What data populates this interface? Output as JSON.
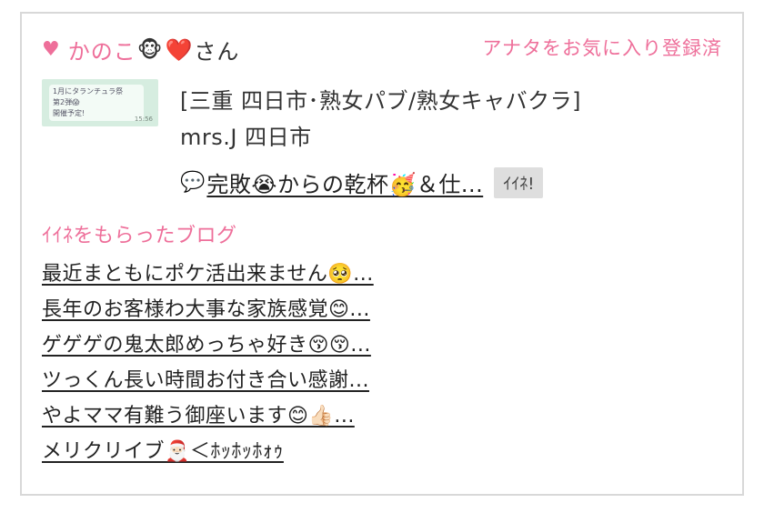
{
  "user": {
    "heart": "♥",
    "name": "かのこ",
    "emojis": [
      "🐵",
      "❤️"
    ],
    "suffix": "さん"
  },
  "favorite_status": "アナタをお気に入り登録済",
  "thumbnail": {
    "line1": "1月にタランチュラ祭",
    "line2": "第2弾😱",
    "line3": "開催予定!",
    "time": "15:56"
  },
  "shop": {
    "category": "[三重 四日市･熟女パブ/熟女キャバクラ]",
    "name": "mrs.J 四日市"
  },
  "post": {
    "icon": "💬",
    "title": "完敗😭からの乾杯🥳＆仕...",
    "iine_label": "ｲｲﾈ!"
  },
  "blogs_section": {
    "title": "ｲｲﾈをもらったブログ",
    "items": [
      "最近まともにポケ活出来ません🥺...",
      "長年のお客様わ大事な家族感覚😊...",
      "ゲゲゲの鬼太郎めっちゃ好き😚😚...",
      "ツっくん長い時間お付き合い感謝...",
      "やよママ有難う御座います😊👍🏻...",
      "メリクリイブ🎅🏻＜ﾎｯﾎｯﾎｫｩ"
    ]
  }
}
